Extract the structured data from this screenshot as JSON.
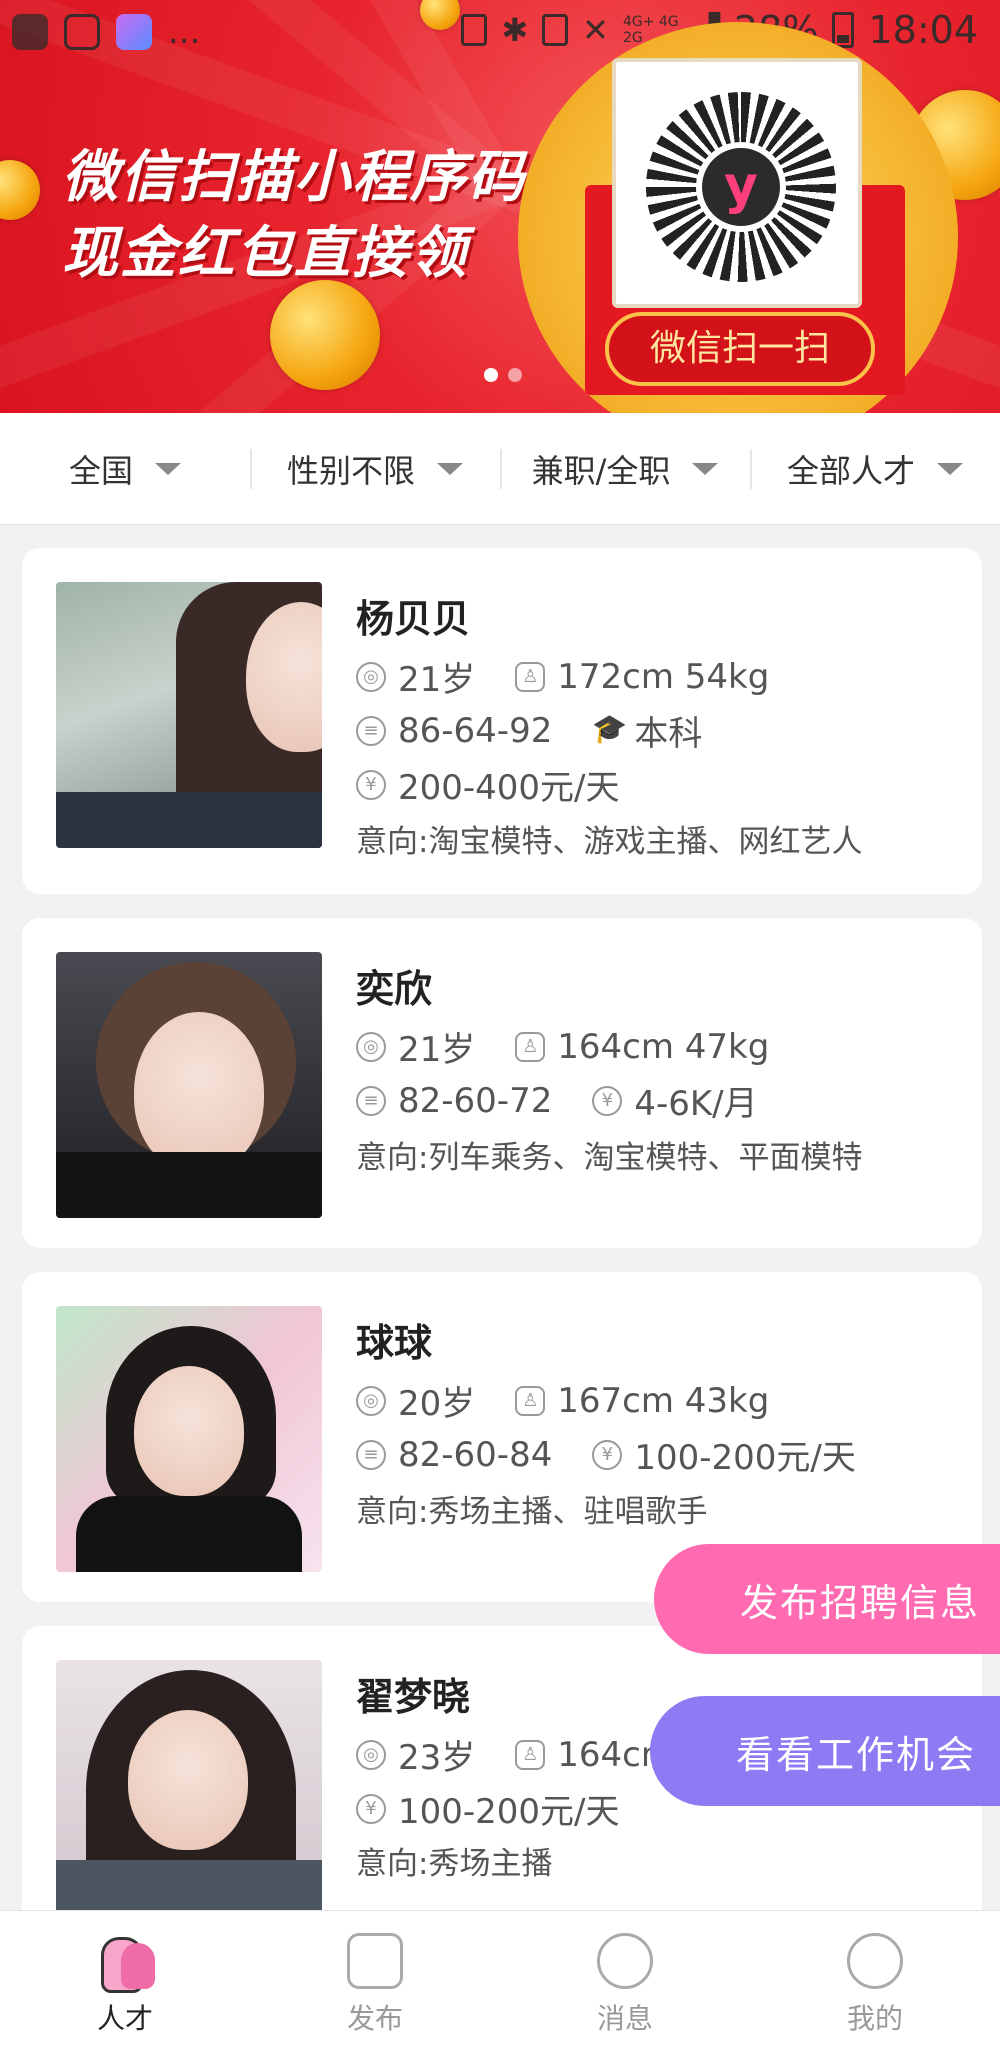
{
  "status_bar": {
    "battery": "28%",
    "time": "18:04",
    "network": "4G+ 4G 2G",
    "more": "..."
  },
  "banner": {
    "line1": "微信扫描小程序码",
    "line2": "现金红包直接领",
    "button": "微信扫一扫",
    "page_count": 2,
    "active_page": 1
  },
  "filters": [
    {
      "label": "全国"
    },
    {
      "label": "性别不限"
    },
    {
      "label": "兼职/全职"
    },
    {
      "label": "全部人才"
    }
  ],
  "talents": [
    {
      "name": "杨贝贝",
      "age": "21岁",
      "height_weight": "172cm 54kg",
      "measurements": "86-64-92",
      "education": "本科",
      "pay": "200-400元/天",
      "intent": "意向:淘宝模特、游戏主播、网红艺人"
    },
    {
      "name": "奕欣",
      "age": "21岁",
      "height_weight": "164cm 47kg",
      "measurements": "82-60-72",
      "pay": "4-6K/月",
      "intent": "意向:列车乘务、淘宝模特、平面模特"
    },
    {
      "name": "球球",
      "age": "20岁",
      "height_weight": "167cm 43kg",
      "measurements": "82-60-84",
      "pay": "100-200元/天",
      "intent": "意向:秀场主播、驻唱歌手"
    },
    {
      "name": "翟梦晓",
      "age": "23岁",
      "height_weight": "164cm",
      "pay": "100-200元/天",
      "intent": "意向:秀场主播"
    }
  ],
  "fab": {
    "post_job": "发布招聘信息",
    "view_jobs": "看看工作机会"
  },
  "nav": [
    {
      "label": "人才",
      "icon": "people-icon",
      "active": true
    },
    {
      "label": "发布",
      "icon": "post-icon",
      "active": false
    },
    {
      "label": "消息",
      "icon": "message-icon",
      "active": false
    },
    {
      "label": "我的",
      "icon": "profile-icon",
      "active": false
    }
  ]
}
